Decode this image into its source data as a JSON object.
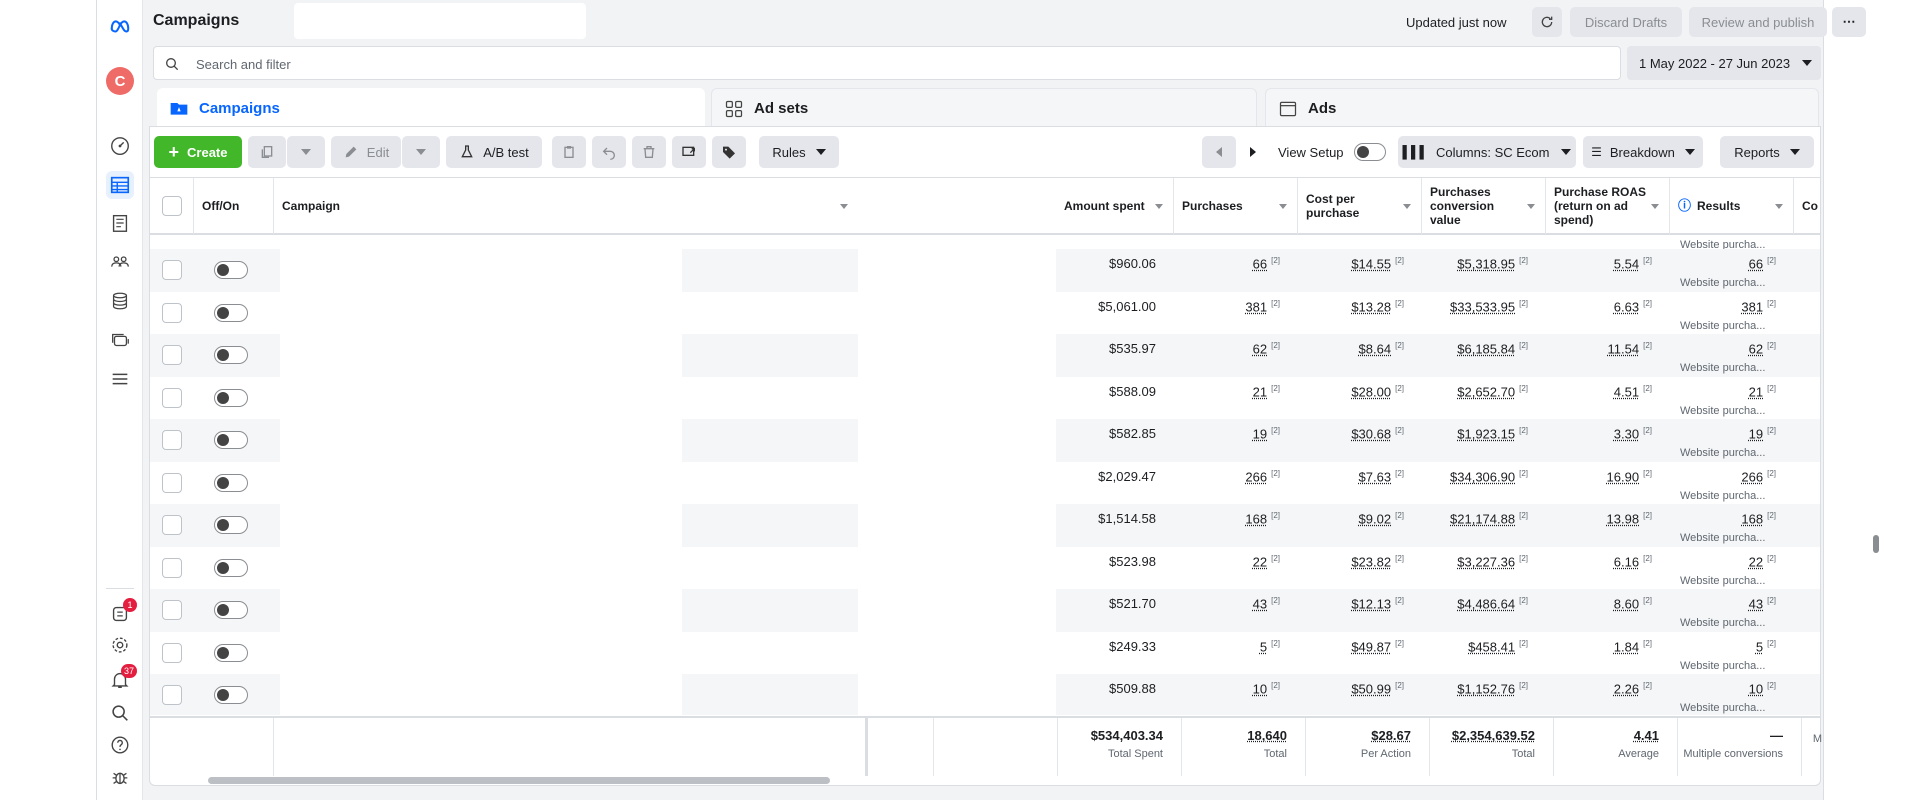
{
  "header": {
    "title": "Campaigns",
    "updated": "Updated just now",
    "discard": "Discard Drafts",
    "review": "Review and publish"
  },
  "search": {
    "placeholder": "Search and filter"
  },
  "date_range": "1 May 2022 - 27 Jun 2023",
  "tabs": [
    {
      "label": "Campaigns"
    },
    {
      "label": "Ad sets"
    },
    {
      "label": "Ads"
    }
  ],
  "toolbar": {
    "create": "Create",
    "edit": "Edit",
    "ab_test": "A/B test",
    "rules": "Rules",
    "view_setup": "View Setup",
    "columns": "Columns: SC Ecom",
    "breakdown": "Breakdown",
    "reports": "Reports"
  },
  "columns": {
    "offon": "Off/On",
    "campaign": "Campaign",
    "amount_spent": "Amount spent",
    "purchases": "Purchases",
    "cost_per_purchase": "Cost per purchase",
    "conv_value": "Purchases conversion value",
    "roas": "Purchase ROAS (return on ad spend)",
    "results": "Results",
    "next": "Co"
  },
  "results_sub": "Website purcha...",
  "rows": [
    {
      "amount": "$960.06",
      "purchases": "66",
      "cpp": "$14.55",
      "value": "$5,318.95",
      "roas": "5.54",
      "results": "66"
    },
    {
      "amount": "$5,061.00",
      "purchases": "381",
      "cpp": "$13.28",
      "value": "$33,533.95",
      "roas": "6.63",
      "results": "381"
    },
    {
      "amount": "$535.97",
      "purchases": "62",
      "cpp": "$8.64",
      "value": "$6,185.84",
      "roas": "11.54",
      "results": "62"
    },
    {
      "amount": "$588.09",
      "purchases": "21",
      "cpp": "$28.00",
      "value": "$2,652.70",
      "roas": "4.51",
      "results": "21"
    },
    {
      "amount": "$582.85",
      "purchases": "19",
      "cpp": "$30.68",
      "value": "$1,923.15",
      "roas": "3.30",
      "results": "19"
    },
    {
      "amount": "$2,029.47",
      "purchases": "266",
      "cpp": "$7.63",
      "value": "$34,306.90",
      "roas": "16.90",
      "results": "266"
    },
    {
      "amount": "$1,514.58",
      "purchases": "168",
      "cpp": "$9.02",
      "value": "$21,174.88",
      "roas": "13.98",
      "results": "168"
    },
    {
      "amount": "$523.98",
      "purchases": "22",
      "cpp": "$23.82",
      "value": "$3,227.36",
      "roas": "6.16",
      "results": "22"
    },
    {
      "amount": "$521.70",
      "purchases": "43",
      "cpp": "$12.13",
      "value": "$4,486.64",
      "roas": "8.60",
      "results": "43"
    },
    {
      "amount": "$249.33",
      "purchases": "5",
      "cpp": "$49.87",
      "value": "$458.41",
      "roas": "1.84",
      "results": "5"
    },
    {
      "amount": "$509.88",
      "purchases": "10",
      "cpp": "$50.99",
      "value": "$1,152.76",
      "roas": "2.26",
      "results": "10"
    }
  ],
  "footer": {
    "amount": "$534,403.34",
    "amount_label": "Total Spent",
    "purchases": "18,640",
    "purchases_label": "Total",
    "cpp": "$28.67",
    "cpp_label": "Per Action",
    "value": "$2,354,639.52",
    "value_label": "Total",
    "roas": "4.41",
    "roas_label": "Average",
    "results": "—",
    "results_label": "Multiple conversions",
    "next_label": "M"
  },
  "badges": {
    "ads_manager": "1",
    "notifications": "37"
  },
  "avatar_initial": "C",
  "colors": {
    "brand_blue": "#0866ff",
    "create_green": "#42b72a",
    "badge_red": "#e41e3f"
  }
}
